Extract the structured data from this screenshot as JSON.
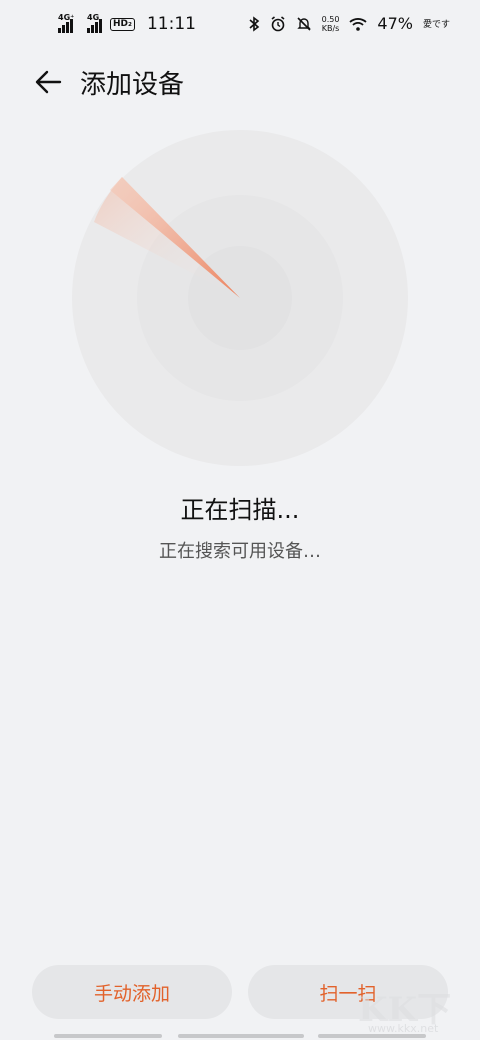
{
  "status_bar": {
    "net1": "4G⁺",
    "net2": "4G",
    "hd": "HD₂",
    "time": "11:11",
    "speed_value": "0.50",
    "speed_unit": "KB/s",
    "battery": "47%",
    "extra": "愛です"
  },
  "header": {
    "title": "添加设备"
  },
  "scan": {
    "title": "正在扫描...",
    "subtitle": "正在搜索可用设备…"
  },
  "buttons": {
    "manual_add": "手动添加",
    "scan_code": "扫一扫"
  },
  "watermark": {
    "text": "KK下载",
    "url": "www.kkx.net"
  },
  "colors": {
    "accent": "#e2622b",
    "background": "#f1f2f4"
  }
}
